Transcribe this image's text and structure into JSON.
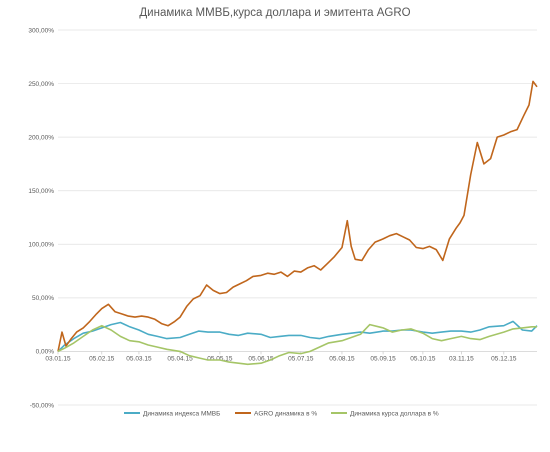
{
  "chart_data": {
    "type": "line",
    "title": "Динамика ММВБ,курса доллара и эмитента AGRO",
    "xlabel": "",
    "ylabel": "",
    "ylim": [
      -0.5,
      3.0
    ],
    "y_ticks": [
      "-50,00%",
      "0,00%",
      "50,00%",
      "100,00%",
      "150,00%",
      "200,00%",
      "250,00%",
      "300,00%"
    ],
    "y_tick_values": [
      -0.5,
      0,
      0.5,
      1.0,
      1.5,
      2.0,
      2.5,
      3.0
    ],
    "x_tick_labels": [
      "03.01.15",
      "05.02.15",
      "05.03.15",
      "05.04.15",
      "05.05.15",
      "05.06.15",
      "05.07.15",
      "05.08.15",
      "05.09.15",
      "05.10.15",
      "03.11.15",
      "05.12.15"
    ],
    "x_tick_values": [
      "2015-01-03",
      "2015-02-05",
      "2015-03-05",
      "2015-04-05",
      "2015-05-05",
      "2015-06-05",
      "2015-07-05",
      "2015-08-05",
      "2015-09-05",
      "2015-10-05",
      "2015-11-03",
      "2015-12-05"
    ],
    "x_range": [
      "2015-01-03",
      "2015-12-30"
    ],
    "grid": "horizontal",
    "legend_position": "bottom",
    "series": [
      {
        "name": "Динамика индекса ММВБ",
        "color": "#4bacc6",
        "x": [
          "2015-01-03",
          "2015-01-08",
          "2015-01-15",
          "2015-01-22",
          "2015-01-29",
          "2015-02-05",
          "2015-02-12",
          "2015-02-19",
          "2015-02-26",
          "2015-03-05",
          "2015-03-12",
          "2015-03-19",
          "2015-03-26",
          "2015-04-05",
          "2015-04-12",
          "2015-04-19",
          "2015-04-26",
          "2015-05-05",
          "2015-05-12",
          "2015-05-19",
          "2015-05-26",
          "2015-06-05",
          "2015-06-12",
          "2015-06-19",
          "2015-06-26",
          "2015-07-05",
          "2015-07-12",
          "2015-07-19",
          "2015-07-26",
          "2015-08-05",
          "2015-08-12",
          "2015-08-19",
          "2015-08-26",
          "2015-09-05",
          "2015-09-12",
          "2015-09-19",
          "2015-09-26",
          "2015-10-05",
          "2015-10-12",
          "2015-10-19",
          "2015-10-26",
          "2015-11-03",
          "2015-11-10",
          "2015-11-17",
          "2015-11-24",
          "2015-12-05",
          "2015-12-12",
          "2015-12-19",
          "2015-12-26",
          "2015-12-30"
        ],
        "values": [
          0.0,
          0.06,
          0.12,
          0.17,
          0.19,
          0.22,
          0.25,
          0.27,
          0.23,
          0.2,
          0.16,
          0.14,
          0.12,
          0.13,
          0.16,
          0.19,
          0.18,
          0.18,
          0.16,
          0.15,
          0.17,
          0.16,
          0.13,
          0.14,
          0.15,
          0.15,
          0.13,
          0.12,
          0.14,
          0.16,
          0.17,
          0.18,
          0.17,
          0.19,
          0.19,
          0.2,
          0.2,
          0.18,
          0.17,
          0.18,
          0.19,
          0.19,
          0.18,
          0.2,
          0.23,
          0.24,
          0.28,
          0.2,
          0.19,
          0.24
        ]
      },
      {
        "name": "AGRO динамика в %",
        "color": "#c0661c",
        "x": [
          "2015-01-03",
          "2015-01-06",
          "2015-01-09",
          "2015-01-13",
          "2015-01-17",
          "2015-01-22",
          "2015-01-27",
          "2015-02-01",
          "2015-02-05",
          "2015-02-10",
          "2015-02-15",
          "2015-02-20",
          "2015-02-25",
          "2015-03-02",
          "2015-03-07",
          "2015-03-12",
          "2015-03-17",
          "2015-03-22",
          "2015-03-27",
          "2015-04-01",
          "2015-04-05",
          "2015-04-10",
          "2015-04-15",
          "2015-04-20",
          "2015-04-25",
          "2015-04-30",
          "2015-05-05",
          "2015-05-10",
          "2015-05-15",
          "2015-05-20",
          "2015-05-25",
          "2015-05-30",
          "2015-06-05",
          "2015-06-10",
          "2015-06-15",
          "2015-06-20",
          "2015-06-25",
          "2015-06-30",
          "2015-07-05",
          "2015-07-10",
          "2015-07-15",
          "2015-07-20",
          "2015-07-25",
          "2015-07-30",
          "2015-08-05",
          "2015-08-09",
          "2015-08-12",
          "2015-08-15",
          "2015-08-20",
          "2015-08-25",
          "2015-08-30",
          "2015-09-05",
          "2015-09-10",
          "2015-09-15",
          "2015-09-20",
          "2015-09-25",
          "2015-09-30",
          "2015-10-05",
          "2015-10-10",
          "2015-10-15",
          "2015-10-20",
          "2015-10-25",
          "2015-10-30",
          "2015-11-02",
          "2015-11-05",
          "2015-11-10",
          "2015-11-15",
          "2015-11-20",
          "2015-11-25",
          "2015-11-30",
          "2015-12-05",
          "2015-12-10",
          "2015-12-15",
          "2015-12-20",
          "2015-12-24",
          "2015-12-27",
          "2015-12-30"
        ],
        "values": [
          0.0,
          0.18,
          0.05,
          0.12,
          0.18,
          0.22,
          0.28,
          0.35,
          0.4,
          0.44,
          0.37,
          0.35,
          0.33,
          0.32,
          0.33,
          0.32,
          0.3,
          0.26,
          0.24,
          0.28,
          0.32,
          0.42,
          0.49,
          0.52,
          0.62,
          0.57,
          0.54,
          0.55,
          0.6,
          0.63,
          0.66,
          0.7,
          0.71,
          0.73,
          0.72,
          0.74,
          0.7,
          0.75,
          0.74,
          0.78,
          0.8,
          0.76,
          0.82,
          0.88,
          0.97,
          1.22,
          0.98,
          0.86,
          0.85,
          0.95,
          1.02,
          1.05,
          1.08,
          1.1,
          1.07,
          1.04,
          0.97,
          0.96,
          0.98,
          0.95,
          0.85,
          1.05,
          1.15,
          1.2,
          1.27,
          1.65,
          1.95,
          1.75,
          1.8,
          2.0,
          2.02,
          2.05,
          2.07,
          2.2,
          2.3,
          2.52,
          2.47
        ]
      },
      {
        "name": "Динамика курса доллара в %",
        "color": "#a5c567",
        "x": [
          "2015-01-03",
          "2015-01-08",
          "2015-01-15",
          "2015-01-22",
          "2015-01-29",
          "2015-02-05",
          "2015-02-12",
          "2015-02-19",
          "2015-02-26",
          "2015-03-05",
          "2015-03-12",
          "2015-03-19",
          "2015-03-26",
          "2015-04-05",
          "2015-04-12",
          "2015-04-19",
          "2015-04-26",
          "2015-05-05",
          "2015-05-12",
          "2015-05-19",
          "2015-05-26",
          "2015-06-05",
          "2015-06-12",
          "2015-06-19",
          "2015-06-26",
          "2015-07-05",
          "2015-07-12",
          "2015-07-19",
          "2015-07-26",
          "2015-08-05",
          "2015-08-12",
          "2015-08-19",
          "2015-08-26",
          "2015-09-05",
          "2015-09-12",
          "2015-09-19",
          "2015-09-26",
          "2015-10-05",
          "2015-10-12",
          "2015-10-19",
          "2015-10-26",
          "2015-11-03",
          "2015-11-10",
          "2015-11-17",
          "2015-11-24",
          "2015-12-05",
          "2015-12-12",
          "2015-12-19",
          "2015-12-26",
          "2015-12-30"
        ],
        "values": [
          0.0,
          0.03,
          0.08,
          0.14,
          0.2,
          0.24,
          0.2,
          0.14,
          0.1,
          0.09,
          0.06,
          0.04,
          0.02,
          0.0,
          -0.04,
          -0.06,
          -0.08,
          -0.08,
          -0.1,
          -0.11,
          -0.12,
          -0.11,
          -0.08,
          -0.04,
          -0.01,
          -0.02,
          0.0,
          0.04,
          0.08,
          0.1,
          0.13,
          0.16,
          0.25,
          0.22,
          0.18,
          0.2,
          0.21,
          0.17,
          0.12,
          0.1,
          0.12,
          0.14,
          0.12,
          0.11,
          0.14,
          0.18,
          0.21,
          0.22,
          0.23,
          0.23
        ]
      }
    ]
  }
}
